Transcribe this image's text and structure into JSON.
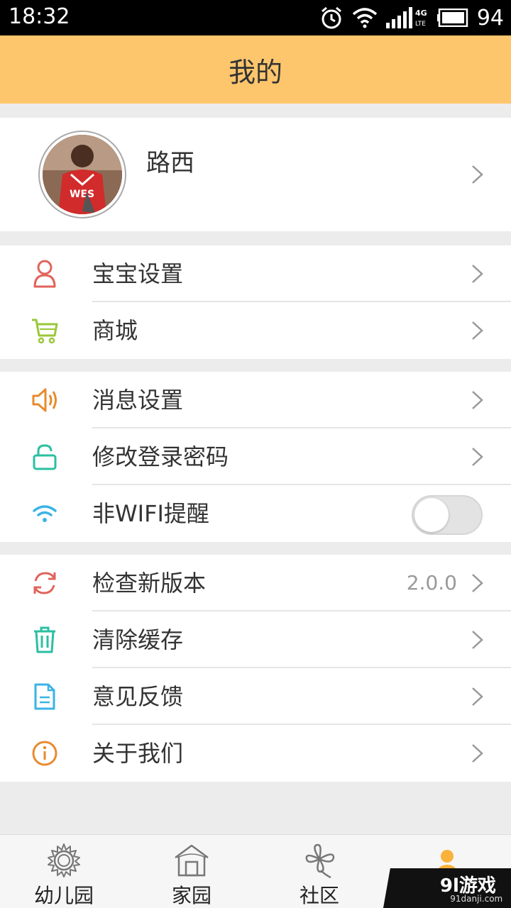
{
  "status_bar": {
    "time": "18:32",
    "network": "4G LTE",
    "battery": "94"
  },
  "header": {
    "title": "我的"
  },
  "profile": {
    "name": "路西"
  },
  "groups": [
    {
      "items": [
        {
          "label": "宝宝设置",
          "icon": "person-icon",
          "color": "#e0645c"
        },
        {
          "label": "商城",
          "icon": "cart-icon",
          "color": "#9ac73a"
        }
      ]
    },
    {
      "items": [
        {
          "label": "消息设置",
          "icon": "speaker-icon",
          "color": "#e98a2e"
        },
        {
          "label": "修改登录密码",
          "icon": "lock-icon",
          "color": "#2bbfa0"
        },
        {
          "label": "非WIFI提醒",
          "icon": "wifi-icon",
          "color": "#3ab3e6",
          "toggle": false
        }
      ]
    },
    {
      "items": [
        {
          "label": "检查新版本",
          "icon": "refresh-icon",
          "color": "#e0645c",
          "value": "2.0.0"
        },
        {
          "label": "清除缓存",
          "icon": "trash-icon",
          "color": "#2bbfa0"
        },
        {
          "label": "意见反馈",
          "icon": "document-icon",
          "color": "#3ab3e6"
        },
        {
          "label": "关于我们",
          "icon": "info-icon",
          "color": "#e98a2e"
        }
      ]
    }
  ],
  "tabs": [
    {
      "label": "幼儿园",
      "icon": "sun-icon"
    },
    {
      "label": "家园",
      "icon": "house-icon"
    },
    {
      "label": "社区",
      "icon": "clover-icon"
    },
    {
      "label": "",
      "icon": "person-tab-icon",
      "active": true
    }
  ],
  "watermark": {
    "text": "9l游戏",
    "sub": "91danji.com"
  },
  "colors": {
    "header_bg": "#fec66c",
    "active_tab": "#fab23a"
  }
}
